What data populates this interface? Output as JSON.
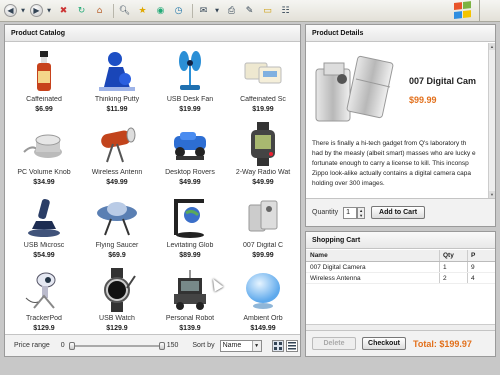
{
  "browser": {
    "toolbar_icons": [
      "back-icon",
      "forward-icon",
      "refresh-icon",
      "home-icon",
      "search-icon",
      "favorites-icon",
      "media-icon",
      "history-icon",
      "mail-icon",
      "print-icon",
      "edit-icon",
      "folder-icon",
      "discuss-icon"
    ],
    "logo_colors": [
      "#e8542a",
      "#7cb342",
      "#2f8ee0",
      "#f5c400"
    ]
  },
  "catalog": {
    "title": "Product Catalog",
    "products": [
      {
        "name": "Caffeinated",
        "price": "$6.99",
        "icon": "hot-sauce-bottle"
      },
      {
        "name": "Thinking Putty",
        "price": "$11.99",
        "icon": "putty-figure"
      },
      {
        "name": "USB Desk Fan",
        "price": "$19.99",
        "icon": "desk-fan"
      },
      {
        "name": "Caffeinated Sc",
        "price": "$19.99",
        "icon": "soap-bars"
      },
      {
        "name": "PC Volume Knob",
        "price": "$34.99",
        "icon": "volume-knob"
      },
      {
        "name": "Wireless Antenn",
        "price": "$49.99",
        "icon": "antenna"
      },
      {
        "name": "Desktop Rovers",
        "price": "$49.99",
        "icon": "rover-car"
      },
      {
        "name": "2-Way Radio Wat",
        "price": "$49.99",
        "icon": "radio-watch"
      },
      {
        "name": "USB Microsc",
        "price": "$54.99",
        "icon": "microscope"
      },
      {
        "name": "Flying Saucer",
        "price": "$69.9",
        "icon": "flying-saucer"
      },
      {
        "name": "Levitating Glob",
        "price": "$89.99",
        "icon": "levitating-globe"
      },
      {
        "name": "007 Digital C",
        "price": "$99.99",
        "icon": "lighter-camera"
      },
      {
        "name": "TrackerPod",
        "price": "$129.9",
        "icon": "tracker-pod"
      },
      {
        "name": "USB Watch",
        "price": "$129.9",
        "icon": "usb-watch"
      },
      {
        "name": "Personal Robot",
        "price": "$139.9",
        "icon": "personal-robot"
      },
      {
        "name": "Ambient Orb",
        "price": "$149.99",
        "icon": "ambient-orb"
      }
    ],
    "price_range_label": "Price range",
    "price_min": "0",
    "price_max": "150",
    "sort_label": "Sort by",
    "sort_value": "Name"
  },
  "details": {
    "title": "Product Details",
    "product_name": "007 Digital Cam",
    "price": "$99.99",
    "description_lines": [
      "There is finally a hi-tech gadget from Q's laboratory th",
      "had by the measly (albeit smart) masses who are lucky e",
      "fortunate enough to carry a license to kill. This inconsp",
      "Zippo look-alike actually contains a digital camera capa",
      "holding over 300 images."
    ],
    "quantity_label": "Quantity",
    "quantity_value": "1",
    "add_button": "Add to Cart"
  },
  "cart": {
    "title": "Shopping Cart",
    "columns": [
      "Name",
      "Qty",
      "P"
    ],
    "rows": [
      {
        "name": "007 Digital Camera",
        "qty": "1",
        "price": "9"
      },
      {
        "name": "Wireless Antenna",
        "qty": "2",
        "price": "4"
      }
    ],
    "delete_button": "Delete",
    "checkout_button": "Checkout",
    "total": "Total: $199.97"
  },
  "colors": {
    "accent": "#e2701c"
  }
}
